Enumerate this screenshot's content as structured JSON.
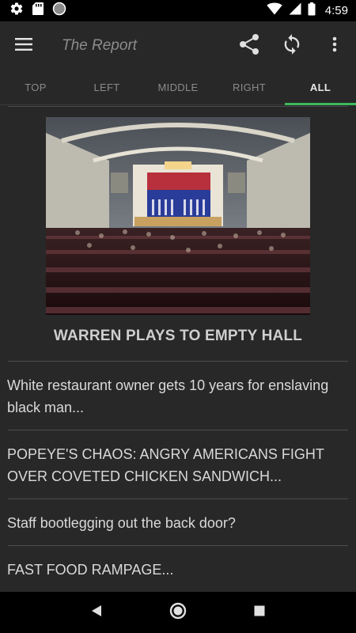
{
  "status_bar": {
    "time": "4:59",
    "icons": [
      "gear-icon",
      "sd-card-icon",
      "circle-icon",
      "wifi-icon",
      "signal-icon",
      "battery-icon"
    ]
  },
  "app_bar": {
    "title": "The Report",
    "icons": [
      "menu-icon",
      "share-icon",
      "refresh-icon",
      "overflow-menu-icon"
    ]
  },
  "tabs": [
    {
      "label": "TOP",
      "active": false
    },
    {
      "label": "LEFT",
      "active": false
    },
    {
      "label": "MIDDLE",
      "active": false
    },
    {
      "label": "RIGHT",
      "active": false
    },
    {
      "label": "ALL",
      "active": true
    }
  ],
  "feed": {
    "hero": {
      "headline": "WARREN PLAYS TO EMPTY HALL"
    },
    "stories": [
      {
        "title": "White restaurant owner gets 10 years for enslaving black man..."
      },
      {
        "title": "POPEYE'S CHAOS: ANGRY AMERICANS FIGHT OVER COVETED CHICKEN SANDWICH..."
      },
      {
        "title": "Staff bootlegging out the back door?"
      },
      {
        "title": "FAST FOOD RAMPAGE..."
      }
    ]
  },
  "colors": {
    "background": "#282828",
    "tab_indicator": "#3dba5c",
    "title": "#8c8c8c"
  },
  "nav_bar": {
    "icons": [
      "back-icon",
      "home-icon",
      "recents-icon"
    ]
  }
}
